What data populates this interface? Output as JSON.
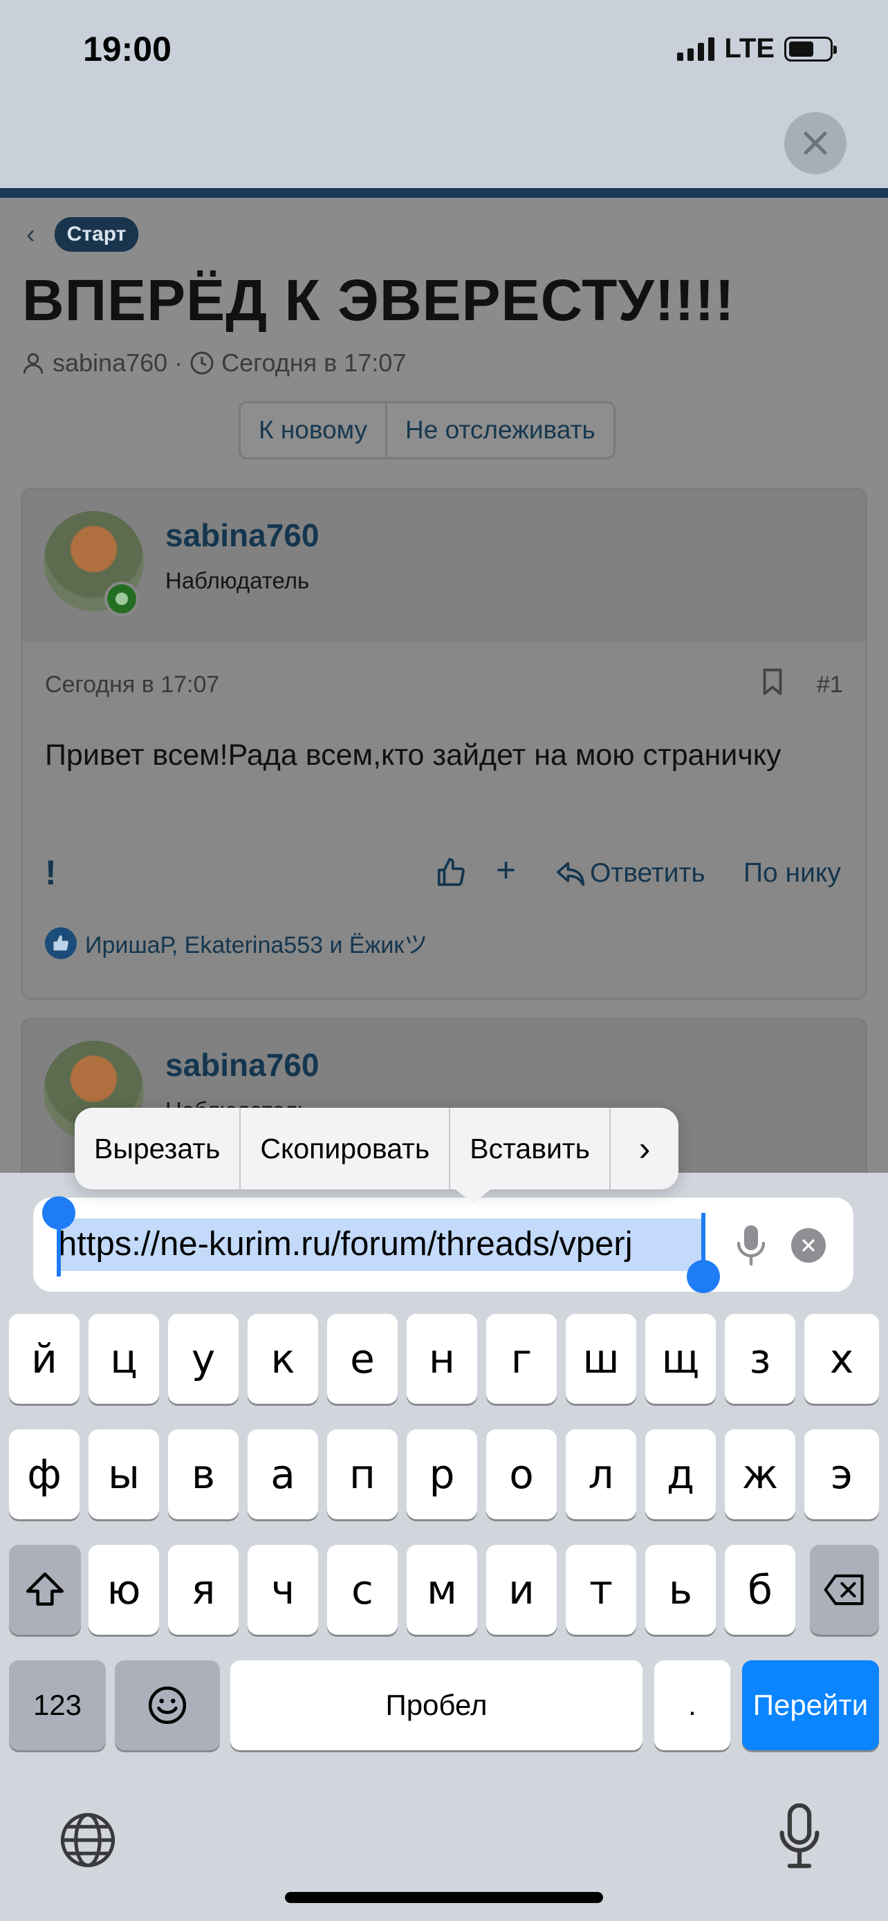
{
  "status_bar": {
    "time": "19:00",
    "network": "LTE"
  },
  "page": {
    "breadcrumb_label": "Старт",
    "title": "ВПЕРЁД К ЭВЕРЕСТУ!!!!",
    "author": "sabina760",
    "date": "Сегодня в 17:07",
    "buttons": {
      "new": "К новому",
      "unwatch": "Не отслеживать"
    }
  },
  "post": {
    "username": "sabina760",
    "role": "Наблюдатель",
    "date": "Сегодня в 17:07",
    "number": "#1",
    "body": "Привет всем!Рада всем,кто зайдет на мою страничку",
    "excl": "!",
    "plus": "+",
    "reply": "Ответить",
    "by_nick": "По нику",
    "likes": "ИришаР, Ekaterina553 и Ёжикツ"
  },
  "post2": {
    "username": "sabina760",
    "role": "Наблюдатель"
  },
  "edit_menu": {
    "cut": "Вырезать",
    "copy": "Скопировать",
    "paste": "Вставить",
    "more": "›"
  },
  "url_field": {
    "value": "https://ne-kurim.ru/forum/threads/vperj"
  },
  "keyboard": {
    "row1": [
      "й",
      "ц",
      "у",
      "к",
      "е",
      "н",
      "г",
      "ш",
      "щ",
      "з",
      "х"
    ],
    "row2": [
      "ф",
      "ы",
      "в",
      "а",
      "п",
      "р",
      "о",
      "л",
      "д",
      "ж",
      "э"
    ],
    "row3": [
      "я",
      "ч",
      "с",
      "м",
      "и",
      "т",
      "ь",
      "б",
      "ю"
    ],
    "numbers": "123",
    "space": "Пробел",
    "dot": ".",
    "go": "Перейти"
  },
  "colors": {
    "accent": "#0a84ff",
    "forum_blue": "#14364f",
    "selection": "#c3dafa"
  }
}
